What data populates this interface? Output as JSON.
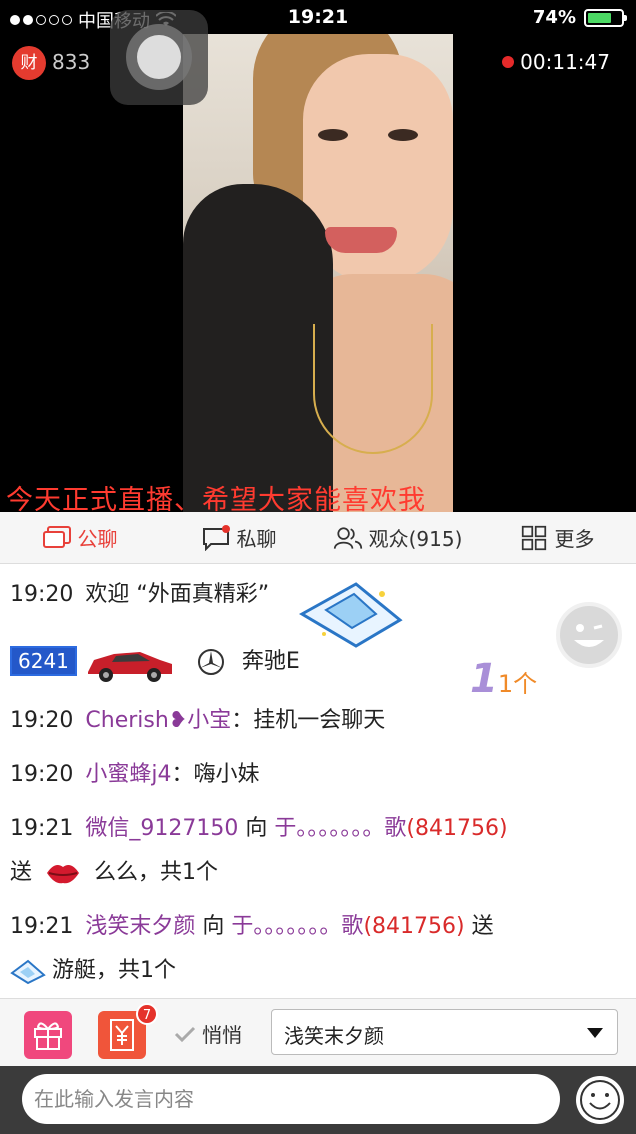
{
  "status_bar": {
    "carrier": "中国移动",
    "time": "19:21",
    "battery": "74%",
    "battery_level": 0.74
  },
  "stream": {
    "coin_icon_label": "财",
    "coin_count": "833",
    "duration": "00:11:47",
    "banner": "今天正式直播、希望大家能喜欢我"
  },
  "tabs": [
    {
      "label": "公聊"
    },
    {
      "label": "私聊"
    },
    {
      "label": "观众(915)"
    },
    {
      "label": "更多"
    }
  ],
  "chat": {
    "m1": {
      "time": "19:20",
      "text": "欢迎 “外面真精彩”"
    },
    "m2": {
      "level": "6241",
      "car": "奔驰E",
      "count": "1个"
    },
    "m3": {
      "time": "19:20",
      "user": "Cherish❥小宝",
      "text": "：挂机一会聊天"
    },
    "m4": {
      "time": "19:20",
      "user": "小蜜蜂j4",
      "text": "：嗨小妹"
    },
    "m5": {
      "time": "19:21",
      "user": "微信_9127150",
      "to": " 向 ",
      "target": "于。。。。。。。歌",
      "target_id": "(841756)",
      "send": "送",
      "gift": "么么，共1个"
    },
    "m6": {
      "time": "19:21",
      "user": "浅笑末夕颜",
      "to": " 向 ",
      "target": "于。。。。。。。歌",
      "target_id": "(841756)",
      "send": " 送",
      "gift": "游艇，共1个"
    }
  },
  "tools": {
    "red_packet_badge": "7",
    "whisper_label": "悄悄",
    "recipient": "浅笑末夕颜"
  },
  "input": {
    "placeholder": "在此输入发言内容"
  }
}
